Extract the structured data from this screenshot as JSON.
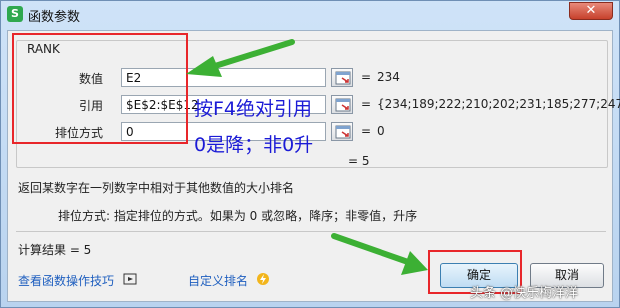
{
  "window": {
    "title": "函数参数",
    "app_icon_text": "S",
    "close_glyph": "✕"
  },
  "function_name": "RANK",
  "args": [
    {
      "label": "数值",
      "value": "E2",
      "result": "234"
    },
    {
      "label": "引用",
      "value": "$E$2:$E$12",
      "result": "{234;189;222;210;202;231;185;277;247..."
    },
    {
      "label": "排位方式",
      "value": "0",
      "result": "0"
    }
  ],
  "equals": "=",
  "formula_result": "= 5",
  "description": "返回某数字在一列数字中相对于其他数值的大小排名",
  "param_description": "排位方式:  指定排位的方式。如果为 0 或忽略，降序；非零值，升序",
  "calc_result": "计算结果 =  5",
  "links": {
    "tips": "查看函数操作技巧",
    "custom_rank": "自定义排名"
  },
  "buttons": {
    "ok": "确定",
    "cancel": "取消"
  },
  "annotations": {
    "line1": "按F4绝对引用",
    "line2": "0是降；非0升",
    "color_box": "#e8262a",
    "color_arrow": "#3cb034",
    "color_text": "#1b1bd6"
  },
  "watermark": "头条 @快乐梅洋洋"
}
